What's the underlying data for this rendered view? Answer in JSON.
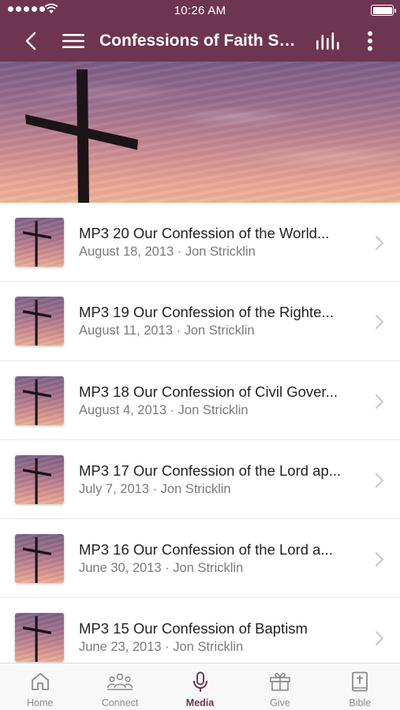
{
  "status_bar": {
    "time": "10:26 AM"
  },
  "navbar": {
    "title": "Confessions of Faith Ser..."
  },
  "colors": {
    "brand": "#6e3550",
    "text": "#222222",
    "subtext": "#7a7a7a",
    "tab_inactive": "#8a8a8a"
  },
  "sermons": [
    {
      "title": "MP3 20 Our Confession of the World...",
      "date": "August 18, 2013",
      "speaker": "Jon Stricklin",
      "subtitle": "August 18, 2013 · Jon Stricklin"
    },
    {
      "title": "MP3 19 Our Confession of the Righte...",
      "date": "August 11, 2013",
      "speaker": "Jon Stricklin",
      "subtitle": "August 11, 2013 · Jon Stricklin"
    },
    {
      "title": "MP3 18 Our Confession of Civil Gover...",
      "date": "August 4, 2013",
      "speaker": "Jon Stricklin",
      "subtitle": "August 4, 2013 · Jon Stricklin"
    },
    {
      "title": "MP3 17 Our Confession of the Lord ap...",
      "date": "July 7, 2013",
      "speaker": "Jon Stricklin",
      "subtitle": "July 7, 2013 · Jon Stricklin"
    },
    {
      "title": "MP3 16 Our Confession of the Lord a...",
      "date": "June 30, 2013",
      "speaker": "Jon Stricklin",
      "subtitle": "June 30, 2013 · Jon Stricklin"
    },
    {
      "title": "MP3 15 Our Confession of Baptism",
      "date": "June 23, 2013",
      "speaker": "Jon Stricklin",
      "subtitle": "June 23, 2013 · Jon Stricklin"
    }
  ],
  "tabs": [
    {
      "label": "Home",
      "icon": "home-icon",
      "active": false
    },
    {
      "label": "Connect",
      "icon": "people-icon",
      "active": false
    },
    {
      "label": "Media",
      "icon": "microphone-icon",
      "active": true
    },
    {
      "label": "Give",
      "icon": "gift-icon",
      "active": false
    },
    {
      "label": "Bible",
      "icon": "bible-icon",
      "active": false
    }
  ]
}
